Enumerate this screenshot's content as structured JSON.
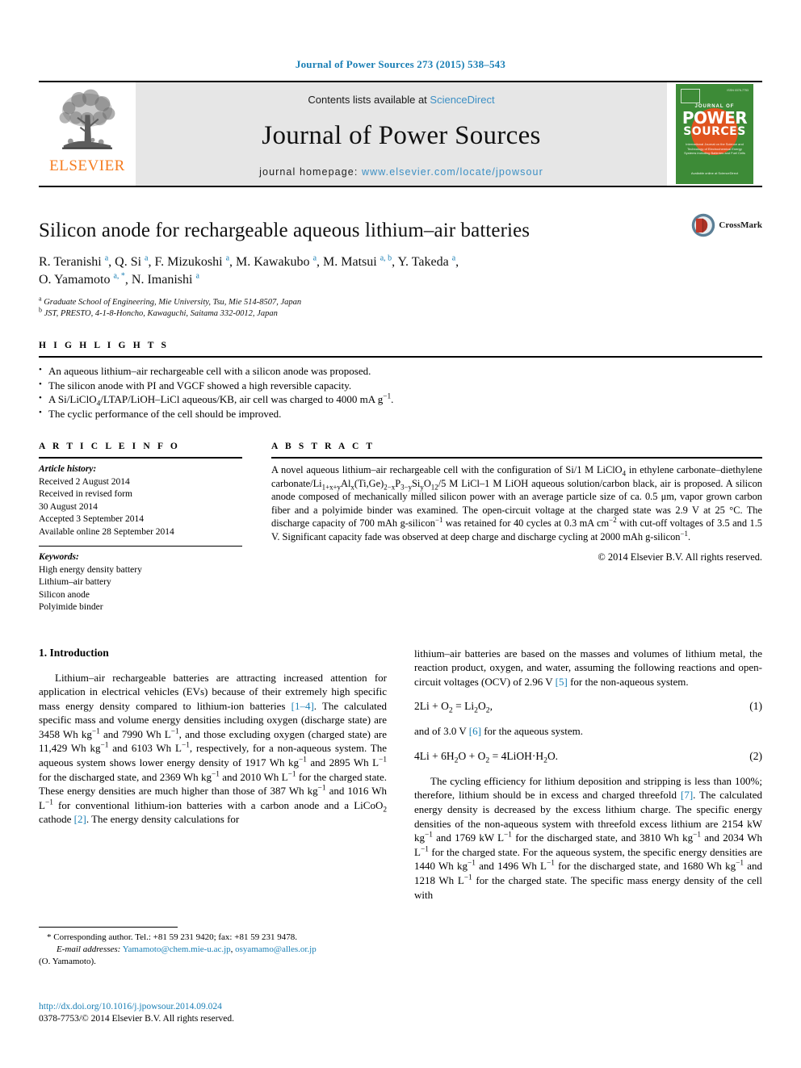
{
  "running_head": "Journal of Power Sources 273 (2015) 538–543",
  "masthead": {
    "contents_prefix": "Contents lists available at ",
    "sciencedirect": "ScienceDirect",
    "journal_name": "Journal of Power Sources",
    "homepage_prefix": "journal homepage: ",
    "homepage_url": "www.elsevier.com/locate/jpowsour",
    "publisher_wordmark": "ELSEVIER",
    "cover": {
      "journal_of": "JOURNAL OF",
      "power": "POWER",
      "sources": "SOURCES",
      "issn": "ISSN 0378-7753",
      "subtitle": "International Journal on the Science and Technology of Electrochemical Energy Systems including Batteries and Fuel Cells",
      "footer": "Available online at\nScienceDirect"
    },
    "colors": {
      "cover_green": "#3d8b37",
      "cover_orange": "#e0541f",
      "elsevier_orange": "#f57c20",
      "link_blue": "#3c8fc4"
    }
  },
  "article": {
    "title": "Silicon anode for rechargeable aqueous lithium–air batteries",
    "authors_line1": "R. Teranishi <sup>a</sup>, Q. Si <sup>a</sup>, F. Mizukoshi <sup>a</sup>, M. Kawakubo <sup>a</sup>, M. Matsui <sup>a, b</sup>, Y. Takeda <sup>a</sup>,",
    "authors_line2": "O. Yamamoto <sup>a, *</sup>, N. Imanishi <sup>a</sup>",
    "affiliations": [
      "<sup>a</sup> Graduate School of Engineering, Mie University, Tsu, Mie 514-8507, Japan",
      "<sup>b</sup> JST, PRESTO, 4-1-8-Honcho, Kawaguchi, Saitama 332-0012, Japan"
    ],
    "crossmark_label": "CrossMark"
  },
  "highlights": {
    "label": "H I G H L I G H T S",
    "items": [
      "An aqueous lithium–air rechargeable cell with a silicon anode was proposed.",
      "The silicon anode with PI and VGCF showed a high reversible capacity.",
      "A Si/LiClO<sub>4</sub>/LTAP/LiOH–LiCl aqueous/KB, air cell was charged to 4000 mA g<sup>−1</sup>.",
      "The cyclic performance of the cell should be improved."
    ]
  },
  "article_info": {
    "label": "A R T I C L E   I N F O",
    "history_label": "Article history:",
    "history": [
      "Received 2 August 2014",
      "Received in revised form",
      "30 August 2014",
      "Accepted 3 September 2014",
      "Available online 28 September 2014"
    ],
    "keywords_label": "Keywords:",
    "keywords": [
      "High energy density battery",
      "Lithium–air battery",
      "Silicon anode",
      "Polyimide binder"
    ]
  },
  "abstract": {
    "label": "A B S T R A C T",
    "text": "A novel aqueous lithium–air rechargeable cell with the configuration of Si/1 M LiClO<sub>4</sub> in ethylene carbonate–diethylene carbonate/Li<sub>1+x+y</sub>Al<sub>x</sub>(Ti,Ge)<sub>2−x</sub>P<sub>3−y</sub>Si<sub>y</sub>O<sub>12</sub>/5 M LiCl–1 M LiOH aqueous solution/carbon black, air is proposed. A silicon anode composed of mechanically milled silicon power with an average particle size of ca. 0.5 μm, vapor grown carbon fiber and a polyimide binder was examined. The open-circuit voltage at the charged state was 2.9 V at 25 °C. The discharge capacity of 700 mAh g-silicon<sup>−1</sup> was retained for 40 cycles at 0.3 mA cm<sup>−2</sup> with cut-off voltages of 3.5 and 1.5 V. Significant capacity fade was observed at deep charge and discharge cycling at 2000 mAh g-silicon<sup>−1</sup>.",
    "copyright": "© 2014 Elsevier B.V. All rights reserved."
  },
  "body": {
    "section_heading": "1.  Introduction",
    "left_paragraph": "Lithium–air rechargeable batteries are attracting increased attention for application in electrical vehicles (EVs) because of their extremely high specific mass energy density compared to lithium-ion batteries <span class=\"ref\">[1–4]</span>. The calculated specific mass and volume energy densities including oxygen (discharge state) are 3458 Wh kg<sup>−1</sup> and 7990 Wh L<sup>−1</sup>, and those excluding oxygen (charged state) are 11,429 Wh kg<sup>−1</sup> and 6103 Wh L<sup>−1</sup>, respectively, for a non-aqueous system. The aqueous system shows lower energy density of 1917 Wh kg<sup>−1</sup> and 2895 Wh L<sup>−1</sup> for the discharged state, and 2369 Wh kg<sup>−1</sup> and 2010 Wh L<sup>−1</sup> for the charged state. These energy densities are much higher than those of 387 Wh kg<sup>−1</sup> and 1016 Wh L<sup>−1</sup> for conventional lithium-ion batteries with a carbon anode and a LiCoO<sub>2</sub> cathode <span class=\"ref\">[2]</span>. The energy density calculations for",
    "right_paragraph_1": "lithium–air batteries are based on the masses and volumes of lithium metal, the reaction product, oxygen, and water, assuming the following reactions and open-circuit voltages (OCV) of 2.96 V <span class=\"ref\">[5]</span> for the non-aqueous system.",
    "equation_1": "2Li + O<sub>2</sub> = Li<sub>2</sub>O<sub>2</sub>,",
    "equation_1_number": "(1)",
    "between_equations": "and of 3.0 V <span class=\"ref\">[6]</span> for the aqueous system.",
    "equation_2": "4Li + 6H<sub>2</sub>O + O<sub>2</sub> = 4LiOH·H<sub>2</sub>O.",
    "equation_2_number": "(2)",
    "right_paragraph_2": "The cycling efficiency for lithium deposition and stripping is less than 100%; therefore, lithium should be in excess and charged threefold <span class=\"ref\">[7]</span>. The calculated energy density is decreased by the excess lithium charge. The specific energy densities of the non-aqueous system with threefold excess lithium are 2154 kW kg<sup>−1</sup> and 1769 kW L<sup>−1</sup> for the discharged state, and 3810 Wh kg<sup>−1</sup> and 2034 Wh L<sup>−1</sup> for the charged state. For the aqueous system, the specific energy densities are 1440 Wh kg<sup>−1</sup> and 1496 Wh L<sup>−1</sup> for the discharged state, and 1680 Wh kg<sup>−1</sup> and 1218 Wh L<sup>−1</sup> for the charged state. The specific mass energy density of the cell with"
  },
  "footnote": {
    "corresponding": "* Corresponding author. Tel.: +81 59 231 9420; fax: +81 59 231 9478.",
    "email_label": "E-mail    addresses:",
    "email_1": "Yamamoto@chem.mie-u.ac.jp",
    "email_2": "osyamamo@alles.or.jp",
    "email_owner": "(O. Yamamoto)."
  },
  "footer": {
    "doi": "http://dx.doi.org/10.1016/j.jpowsour.2014.09.024",
    "issn_copyright": "0378-7753/© 2014 Elsevier B.V. All rights reserved."
  }
}
